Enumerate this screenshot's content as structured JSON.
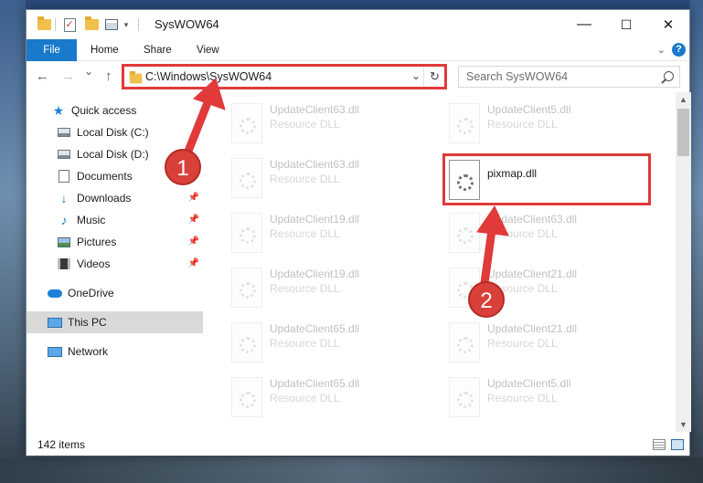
{
  "window": {
    "title": "SysWOW64",
    "controls": {
      "minimize": "—",
      "maximize": "☐",
      "close": "✕"
    }
  },
  "ribbon": {
    "tabs": [
      "File",
      "Home",
      "Share",
      "View"
    ]
  },
  "navigation": {
    "back": "←",
    "forward": "→",
    "recent": "⌄",
    "up": "↑",
    "address": "C:\\Windows\\SysWOW64",
    "address_dropdown": "⌄",
    "refresh": "↻",
    "search_placeholder": "Search SysWOW64"
  },
  "sidebar": {
    "items": [
      {
        "label": "Quick access",
        "icon": "star-icon",
        "pinned": false
      },
      {
        "label": "Local Disk (C:)",
        "icon": "drive-icon",
        "pinned": false
      },
      {
        "label": "Local Disk (D:)",
        "icon": "drive-icon",
        "pinned": false
      },
      {
        "label": "Documents",
        "icon": "documents-icon",
        "pinned": false
      },
      {
        "label": "Downloads",
        "icon": "download-icon",
        "pinned": true
      },
      {
        "label": "Music",
        "icon": "music-icon",
        "pinned": true
      },
      {
        "label": "Pictures",
        "icon": "pictures-icon",
        "pinned": true
      },
      {
        "label": "Videos",
        "icon": "videos-icon",
        "pinned": true
      },
      {
        "label": "OneDrive",
        "icon": "onedrive-icon",
        "pinned": false
      },
      {
        "label": "This PC",
        "icon": "this-pc-icon",
        "pinned": false,
        "selected": true
      },
      {
        "label": "Network",
        "icon": "network-icon",
        "pinned": false
      }
    ]
  },
  "files": {
    "left_column": [
      {
        "name": "UpdateClient63.dll",
        "type": "Resource DLL"
      },
      {
        "name": "UpdateClient63.dll",
        "type": "Resource DLL"
      },
      {
        "name": "UpdateClient19.dll",
        "type": "Resource DLL"
      },
      {
        "name": "UpdateClient19.dll",
        "type": "Resource DLL"
      },
      {
        "name": "UpdateClient65.dll",
        "type": "Resource DLL"
      },
      {
        "name": "UpdateClient65.dll",
        "type": "Resource DLL"
      }
    ],
    "right_column": [
      {
        "name": "UpdateClient5.dll",
        "type": "Resource DLL"
      },
      {
        "name": "pixmap.dll",
        "type": ""
      },
      {
        "name": "UpdateClient63.dll",
        "type": "Resource DLL"
      },
      {
        "name": "UpdateClient21.dll",
        "type": "Resource DLL"
      },
      {
        "name": "UpdateClient21.dll",
        "type": "Resource DLL"
      },
      {
        "name": "UpdateClient5.dll",
        "type": "Resource DLL"
      }
    ]
  },
  "status": {
    "item_count": "142 items"
  },
  "annotations": {
    "step1": "1",
    "step2": "2",
    "color": "#e03a3a"
  }
}
